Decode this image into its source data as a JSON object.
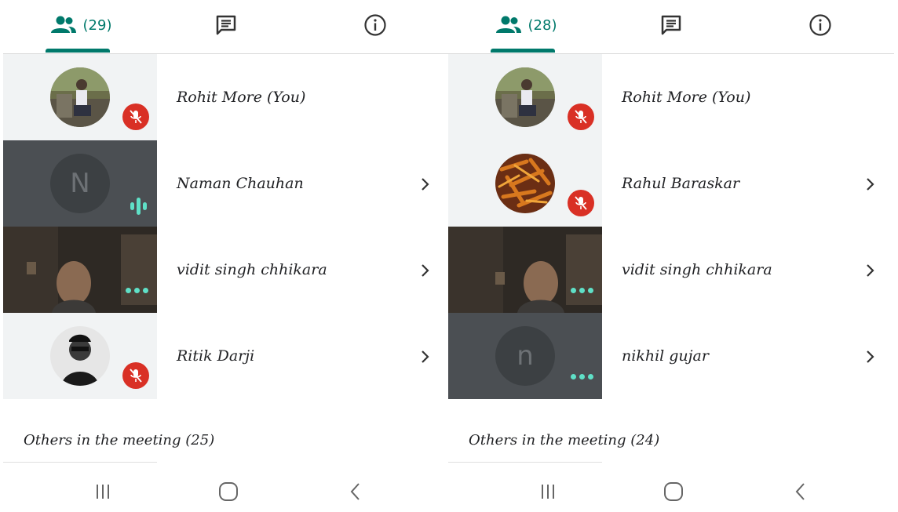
{
  "left": {
    "tabs": {
      "people_count": "(29)"
    },
    "participants": [
      {
        "name": "Rohit More (You)"
      },
      {
        "name": "Naman Chauhan",
        "initial": "N"
      },
      {
        "name": "vidit singh chhikara"
      },
      {
        "name": "Ritik Darji"
      }
    ],
    "others_label": "Others in the meeting (25)"
  },
  "right": {
    "tabs": {
      "people_count": "(28)"
    },
    "participants": [
      {
        "name": "Rohit More (You)"
      },
      {
        "name": "Rahul Baraskar"
      },
      {
        "name": "vidit singh chhikara"
      },
      {
        "name": "nikhil gujar",
        "initial": "n"
      }
    ],
    "others_label": "Others in the meeting (24)"
  },
  "colors": {
    "accent": "#00796b",
    "mute_red": "#d93025",
    "activity_teal": "#5fe0c7",
    "tile_bg": "#f1f3f4",
    "dark_tile_bg": "#4b4f53"
  },
  "icons": [
    "people-icon",
    "chat-icon",
    "info-icon",
    "mic-off-icon",
    "speaking-icon",
    "more-dots-icon",
    "chevron-right-icon",
    "recent-apps-icon",
    "home-icon",
    "back-icon"
  ]
}
